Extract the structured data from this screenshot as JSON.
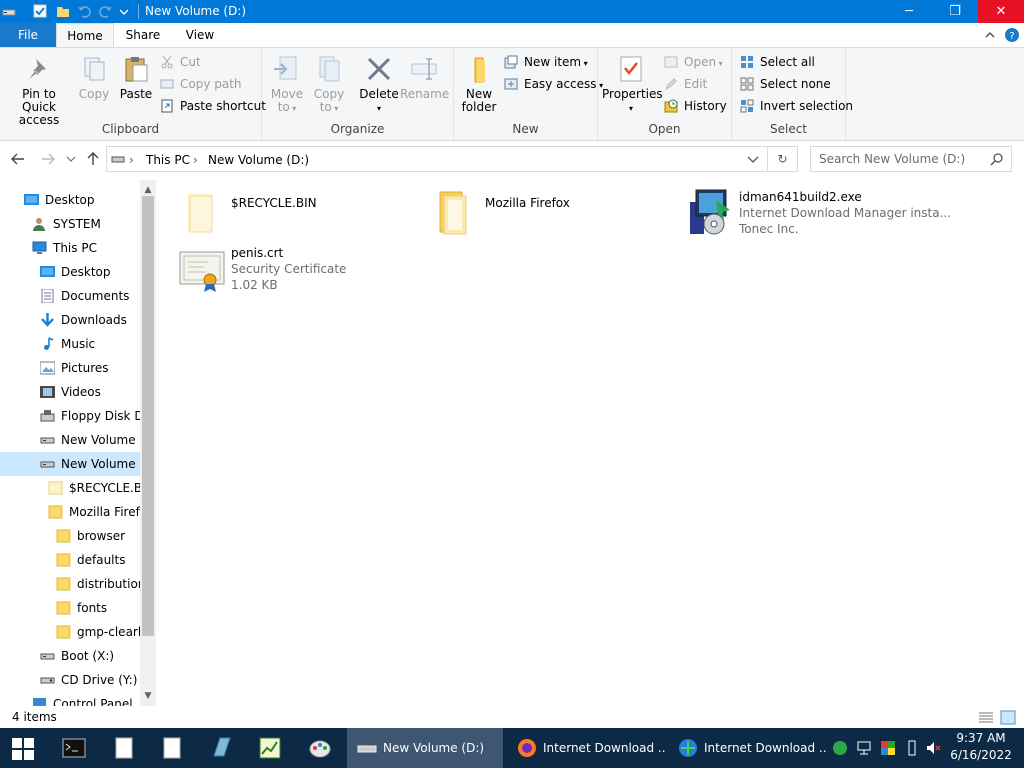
{
  "window": {
    "title": "New Volume (D:)",
    "minimize_glyph": "─",
    "restore_glyph": "❐",
    "close_glyph": "✕"
  },
  "tabs": {
    "file": "File",
    "home": "Home",
    "share": "Share",
    "view": "View"
  },
  "ribbon": {
    "clipboard": {
      "label": "Clipboard",
      "pin_line1": "Pin to Quick",
      "pin_line2": "access",
      "copy": "Copy",
      "paste": "Paste",
      "cut": "Cut",
      "copy_path": "Copy path",
      "paste_shortcut": "Paste shortcut"
    },
    "organize": {
      "label": "Organize",
      "move_line1": "Move",
      "move_line2": "to",
      "copy_line1": "Copy",
      "copy_line2": "to",
      "delete": "Delete",
      "rename": "Rename"
    },
    "new": {
      "label": "New",
      "folder_line1": "New",
      "folder_line2": "folder",
      "new_item": "New item",
      "easy_access": "Easy access"
    },
    "open": {
      "label": "Open",
      "properties": "Properties",
      "open": "Open",
      "edit": "Edit",
      "history": "History"
    },
    "select": {
      "label": "Select",
      "select_all": "Select all",
      "select_none": "Select none",
      "invert": "Invert selection"
    }
  },
  "address": {
    "crumbs": [
      "This PC",
      "New Volume (D:)"
    ],
    "search_placeholder": "Search New Volume (D:)"
  },
  "nav": {
    "items": [
      {
        "label": "Desktop",
        "icon": "desktop-icon"
      },
      {
        "label": "SYSTEM",
        "icon": "user-icon"
      },
      {
        "label": "This PC",
        "icon": "computer-icon"
      },
      {
        "label": "Desktop",
        "icon": "desktop-icon"
      },
      {
        "label": "Documents",
        "icon": "documents-icon"
      },
      {
        "label": "Downloads",
        "icon": "downloads-icon"
      },
      {
        "label": "Music",
        "icon": "music-icon"
      },
      {
        "label": "Pictures",
        "icon": "pictures-icon"
      },
      {
        "label": "Videos",
        "icon": "videos-icon"
      },
      {
        "label": "Floppy Disk Dri",
        "icon": "floppy-icon"
      },
      {
        "label": "New Volume (C",
        "icon": "drive-icon"
      },
      {
        "label": "New Volume (D",
        "icon": "drive-icon"
      },
      {
        "label": "$RECYCLE.BIN",
        "icon": "folder-icon"
      },
      {
        "label": "Mozilla Firefo",
        "icon": "folder-icon"
      },
      {
        "label": "browser",
        "icon": "folder-icon"
      },
      {
        "label": "defaults",
        "icon": "folder-icon"
      },
      {
        "label": "distribution",
        "icon": "folder-icon"
      },
      {
        "label": "fonts",
        "icon": "folder-icon"
      },
      {
        "label": "gmp-clearkey",
        "icon": "folder-icon"
      },
      {
        "label": "Boot (X:)",
        "icon": "drive-icon"
      },
      {
        "label": "CD Drive (Y:) vi",
        "icon": "cd-drive-icon"
      },
      {
        "label": "Control Panel",
        "icon": "control-panel-icon"
      }
    ]
  },
  "files": [
    {
      "name": "$RECYCLE.BIN",
      "type": "folder"
    },
    {
      "name": "Mozilla Firefox",
      "type": "folder"
    },
    {
      "name": "idman641build2.exe",
      "line2": "Internet Download Manager insta...",
      "line3": "Tonec Inc.",
      "type": "installer"
    },
    {
      "name": "penis.crt",
      "line2": "Security Certificate",
      "line3": "1.02 KB",
      "type": "certificate"
    }
  ],
  "status": {
    "item_count": "4 items"
  },
  "taskbar": {
    "tasks": [
      {
        "label": "New Volume (D:)",
        "icon": "file-explorer-icon",
        "active": true
      },
      {
        "label": "Internet Download ...",
        "icon": "firefox-icon",
        "active": false
      },
      {
        "label": "Internet Download ...",
        "icon": "idm-icon",
        "active": false
      }
    ],
    "time": "9:37 AM",
    "date": "6/16/2022"
  }
}
